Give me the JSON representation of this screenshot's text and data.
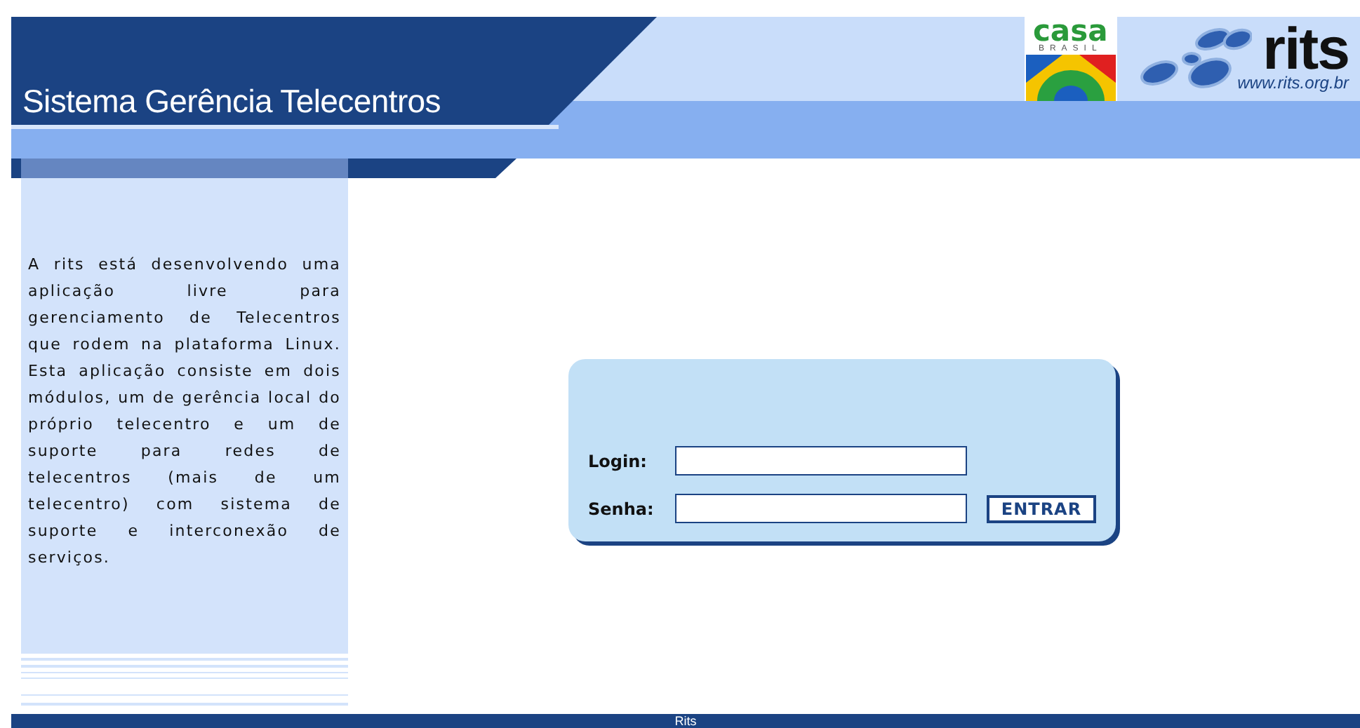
{
  "header": {
    "title": "Sistema Gerência Telecentros",
    "logos": [
      {
        "kind": "casa",
        "word": "casa",
        "subword": "BRASIL"
      },
      {
        "kind": "rits",
        "word": "rits",
        "url": "www.rits.org.br"
      }
    ]
  },
  "sidebar": {
    "text": "A rits está desenvolvendo uma aplicação livre para gerenciamento de Telecentros que rodem na plataforma Linux. Esta aplicação consiste em dois módulos, um de gerência local do próprio telecentro e um de suporte para redes de telecentros (mais de um telecentro) com sistema de suporte e interconexão de serviços."
  },
  "login_form": {
    "fields": [
      {
        "label": "Login:"
      },
      {
        "label": "Senha:"
      }
    ],
    "button": "ENTRAR"
  },
  "footer": "Rits"
}
